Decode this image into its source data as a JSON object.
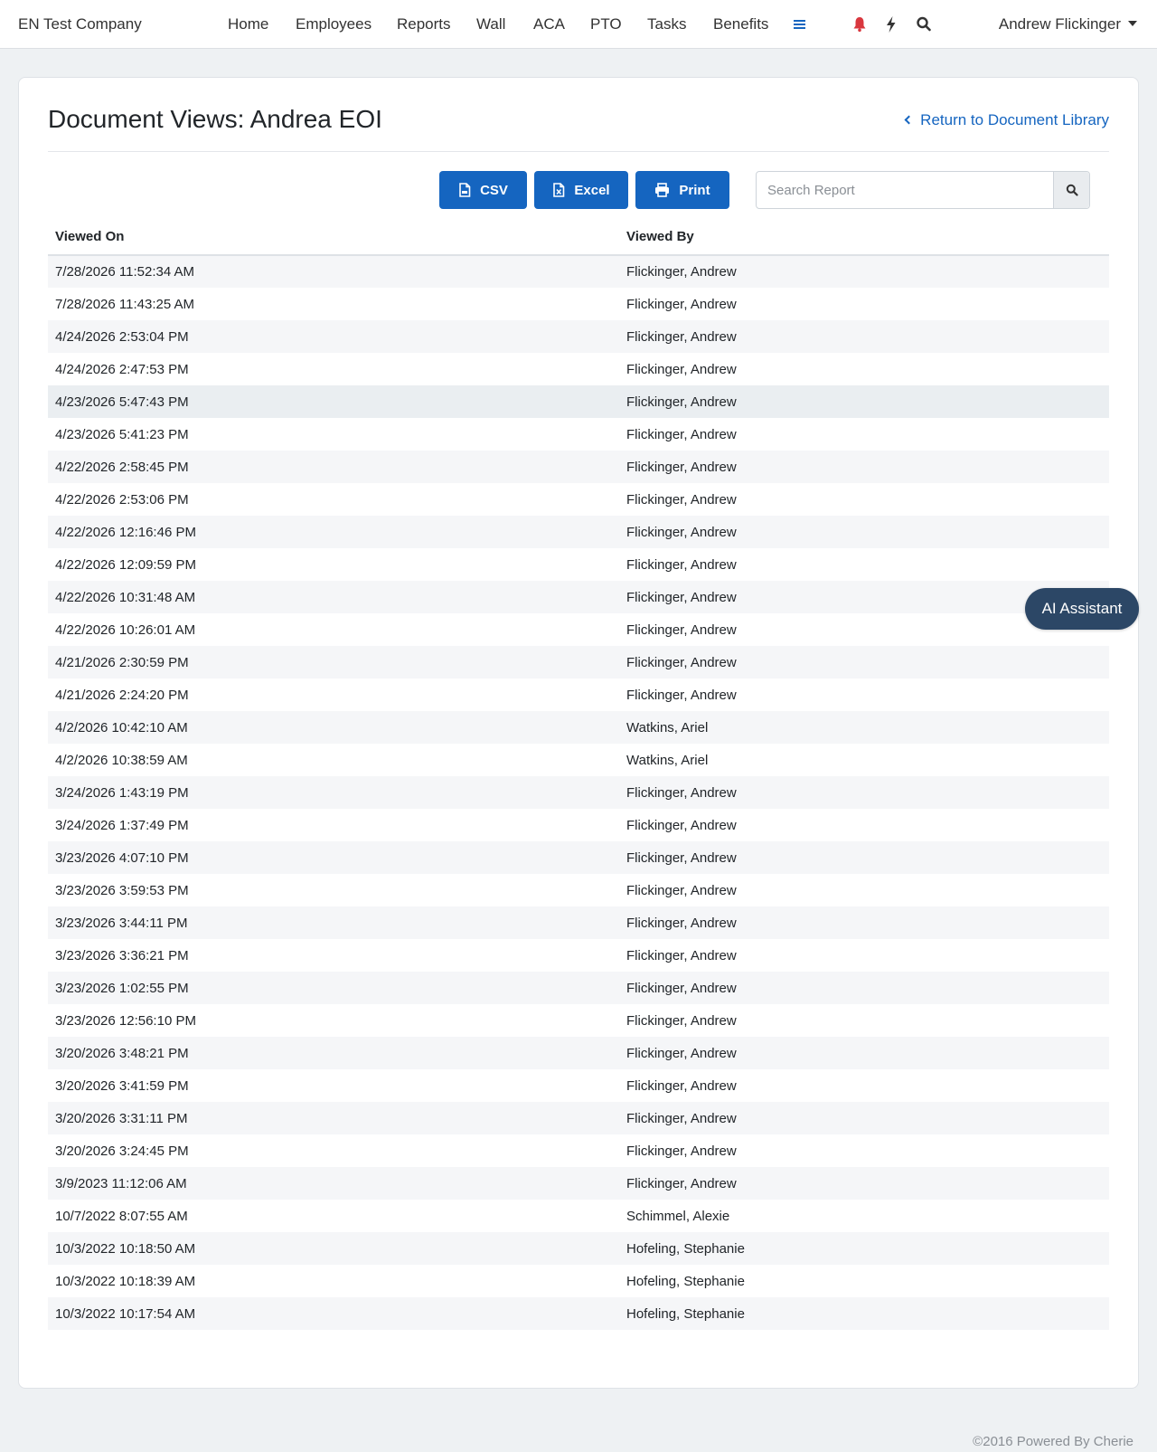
{
  "nav": {
    "brand": "EN Test Company",
    "links": [
      "Home",
      "Employees",
      "Reports",
      "Wall",
      "ACA",
      "PTO",
      "Tasks",
      "Benefits"
    ],
    "user": "Andrew Flickinger",
    "icons": [
      "menu-icon",
      "bell-icon",
      "bolt-icon",
      "search-icon"
    ],
    "colors": {
      "menu": "#1565c0",
      "bell": "#d9373e"
    }
  },
  "page": {
    "title": "Document Views: Andrea EOI",
    "return_label": "Return to Document Library"
  },
  "toolbar": {
    "csv_label": "CSV",
    "excel_label": "Excel",
    "print_label": "Print",
    "search_placeholder": "Search Report",
    "search_value": ""
  },
  "table": {
    "columns": [
      "Viewed On",
      "Viewed By"
    ],
    "rows": [
      [
        "7/28/2026 11:52:34 AM",
        "Flickinger, Andrew"
      ],
      [
        "7/28/2026 11:43:25 AM",
        "Flickinger, Andrew"
      ],
      [
        "4/24/2026 2:53:04 PM",
        "Flickinger, Andrew"
      ],
      [
        "4/24/2026 2:47:53 PM",
        "Flickinger, Andrew"
      ],
      [
        "4/23/2026 5:47:43 PM",
        "Flickinger, Andrew"
      ],
      [
        "4/23/2026 5:41:23 PM",
        "Flickinger, Andrew"
      ],
      [
        "4/22/2026 2:58:45 PM",
        "Flickinger, Andrew"
      ],
      [
        "4/22/2026 2:53:06 PM",
        "Flickinger, Andrew"
      ],
      [
        "4/22/2026 12:16:46 PM",
        "Flickinger, Andrew"
      ],
      [
        "4/22/2026 12:09:59 PM",
        "Flickinger, Andrew"
      ],
      [
        "4/22/2026 10:31:48 AM",
        "Flickinger, Andrew"
      ],
      [
        "4/22/2026 10:26:01 AM",
        "Flickinger, Andrew"
      ],
      [
        "4/21/2026 2:30:59 PM",
        "Flickinger, Andrew"
      ],
      [
        "4/21/2026 2:24:20 PM",
        "Flickinger, Andrew"
      ],
      [
        "4/2/2026 10:42:10 AM",
        "Watkins, Ariel"
      ],
      [
        "4/2/2026 10:38:59 AM",
        "Watkins, Ariel"
      ],
      [
        "3/24/2026 1:43:19 PM",
        "Flickinger, Andrew"
      ],
      [
        "3/24/2026 1:37:49 PM",
        "Flickinger, Andrew"
      ],
      [
        "3/23/2026 4:07:10 PM",
        "Flickinger, Andrew"
      ],
      [
        "3/23/2026 3:59:53 PM",
        "Flickinger, Andrew"
      ],
      [
        "3/23/2026 3:44:11 PM",
        "Flickinger, Andrew"
      ],
      [
        "3/23/2026 3:36:21 PM",
        "Flickinger, Andrew"
      ],
      [
        "3/23/2026 1:02:55 PM",
        "Flickinger, Andrew"
      ],
      [
        "3/23/2026 12:56:10 PM",
        "Flickinger, Andrew"
      ],
      [
        "3/20/2026 3:48:21 PM",
        "Flickinger, Andrew"
      ],
      [
        "3/20/2026 3:41:59 PM",
        "Flickinger, Andrew"
      ],
      [
        "3/20/2026 3:31:11 PM",
        "Flickinger, Andrew"
      ],
      [
        "3/20/2026 3:24:45 PM",
        "Flickinger, Andrew"
      ],
      [
        "3/9/2023 11:12:06 AM",
        "Flickinger, Andrew"
      ],
      [
        "10/7/2022 8:07:55 AM",
        "Schimmel, Alexie"
      ],
      [
        "10/3/2022 10:18:50 AM",
        "Hofeling, Stephanie"
      ],
      [
        "10/3/2022 10:18:39 AM",
        "Hofeling, Stephanie"
      ],
      [
        "10/3/2022 10:17:54 AM",
        "Hofeling, Stephanie"
      ]
    ],
    "highlighted_row": 4
  },
  "assistant": {
    "label": "AI Assistant"
  },
  "footer": {
    "text": "©2016 Powered By Cherie"
  }
}
